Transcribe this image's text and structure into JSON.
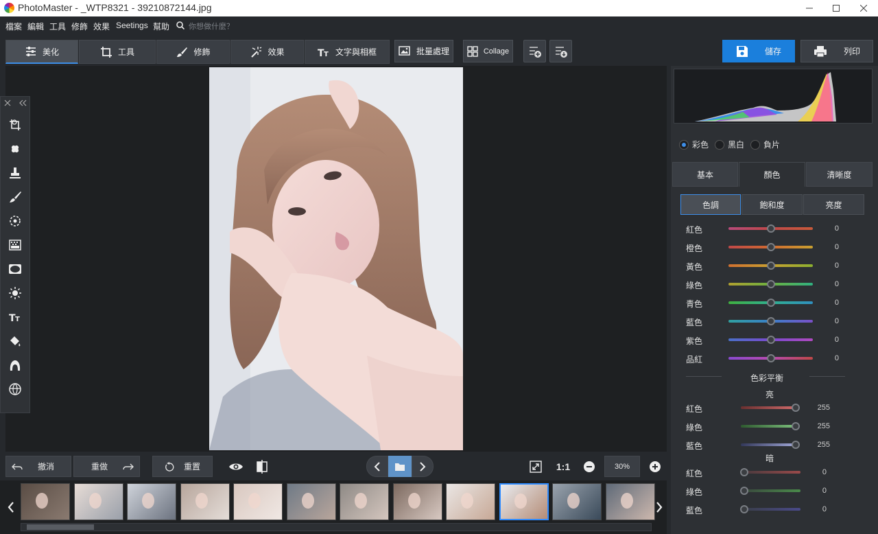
{
  "window": {
    "title": "PhotoMaster - _WTP8321 - 39210872144.jpg"
  },
  "menu": {
    "items": [
      "檔案",
      "編輯",
      "工具",
      "修飾",
      "效果",
      "Seetings",
      "幫助"
    ],
    "search_placeholder": "你想做什麼？"
  },
  "toolbar": {
    "tabs": [
      "美化",
      "工具",
      "修飾",
      "效果",
      "文字與相框"
    ],
    "batch_label": "批量處理",
    "collage_label": "Collage",
    "save_label": "儲存",
    "print_label": "列印"
  },
  "bottom": {
    "undo_label": "撤消",
    "redo_label": "重做",
    "reset_label": "重置",
    "one_to_one": "1:1",
    "zoom": "30%"
  },
  "filmstrip": {
    "selected_index": 9,
    "count": 12
  },
  "histogram": {
    "modes": [
      "彩色",
      "黑白",
      "負片"
    ],
    "selected_mode": "彩色"
  },
  "panel": {
    "tabs": [
      "基本",
      "顏色",
      "清晰度"
    ],
    "active_tab": "顏色",
    "subtabs": [
      "色調",
      "飽和度",
      "亮度"
    ],
    "active_subtab": "色調",
    "hue": [
      {
        "label": "紅色",
        "value": 0
      },
      {
        "label": "橙色",
        "value": 0
      },
      {
        "label": "黃色",
        "value": 0
      },
      {
        "label": "綠色",
        "value": 0
      },
      {
        "label": "青色",
        "value": 0
      },
      {
        "label": "藍色",
        "value": 0
      },
      {
        "label": "紫色",
        "value": 0
      },
      {
        "label": "品紅",
        "value": 0
      }
    ],
    "balance_title": "色彩平衡",
    "bright_title": "亮",
    "bright": [
      {
        "label": "紅色",
        "value": 255
      },
      {
        "label": "綠色",
        "value": 255
      },
      {
        "label": "藍色",
        "value": 255
      }
    ],
    "dark_title": "暗",
    "dark": [
      {
        "label": "紅色",
        "value": 0
      },
      {
        "label": "綠色",
        "value": 0
      },
      {
        "label": "藍色",
        "value": 0
      }
    ]
  },
  "colors": {
    "accent": "#1b7fdc",
    "background": "#26292d",
    "panel": "#2d3034"
  }
}
